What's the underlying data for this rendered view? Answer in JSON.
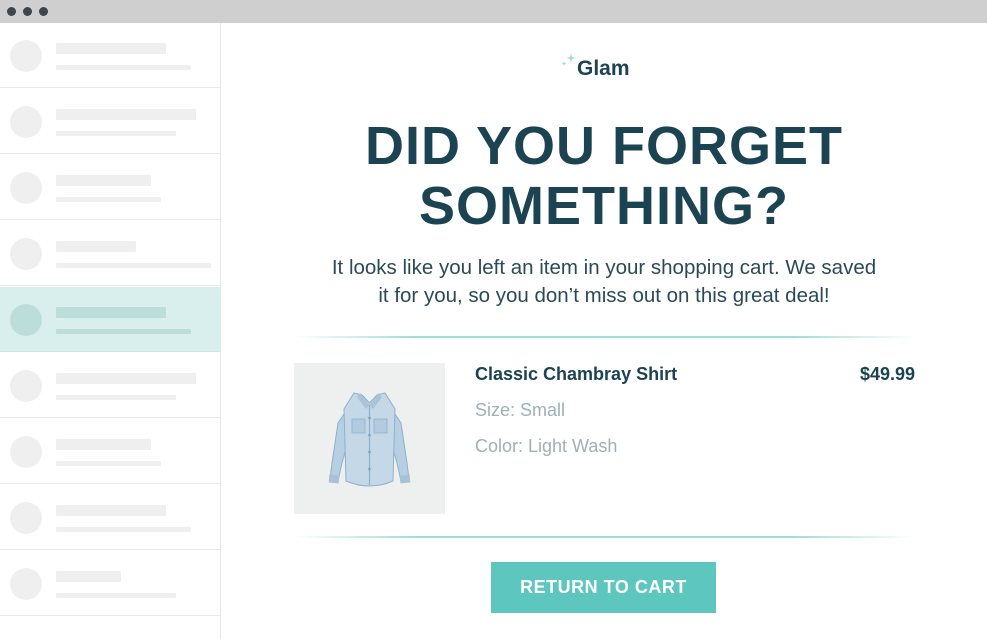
{
  "brand": {
    "name": "Glam",
    "color": "#1b4352",
    "accent": "#5cc6bf"
  },
  "email": {
    "headline_line1": "DID YOU FORGET",
    "headline_line2": "SOMETHING?",
    "body_line1": "It looks like you left an item in your shopping cart. We saved",
    "body_line2": "it for you, so you don’t miss out on this great deal!",
    "product": {
      "name": "Classic Chambray Shirt",
      "price": "$49.99",
      "size": "Size: Small",
      "color": "Color: Light Wash",
      "image_icon": "chambray-shirt-image"
    },
    "cta_label": "RETURN TO CART"
  },
  "sidebar": {
    "selected_index": 4
  }
}
